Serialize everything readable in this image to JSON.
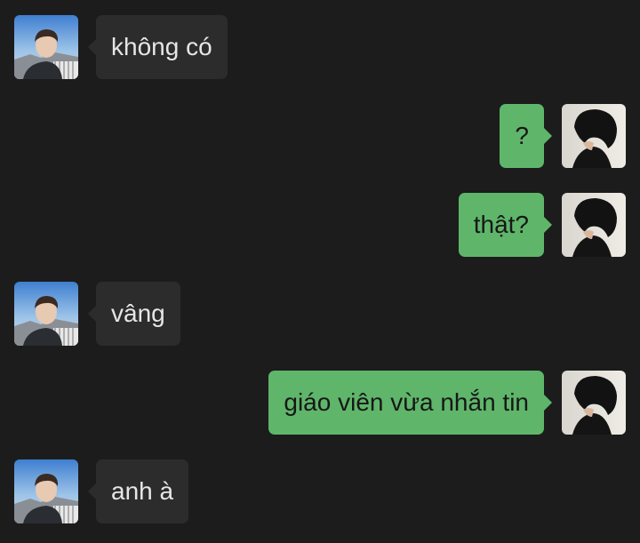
{
  "colors": {
    "background": "#1c1c1c",
    "incoming_bubble": "#2c2c2c",
    "outgoing_bubble": "#5fb66a",
    "incoming_text": "#e6e6e6",
    "outgoing_text": "#171717"
  },
  "messages": [
    {
      "direction": "incoming",
      "text": "không có",
      "avatar": "contact-avatar"
    },
    {
      "direction": "outgoing",
      "text": "?",
      "avatar": "self-avatar"
    },
    {
      "direction": "outgoing",
      "text": "thật?",
      "avatar": "self-avatar"
    },
    {
      "direction": "incoming",
      "text": "vâng",
      "avatar": "contact-avatar"
    },
    {
      "direction": "outgoing",
      "text": "giáo viên vừa nhắn tin",
      "avatar": "self-avatar"
    },
    {
      "direction": "incoming",
      "text": "anh à",
      "avatar": "contact-avatar"
    }
  ]
}
